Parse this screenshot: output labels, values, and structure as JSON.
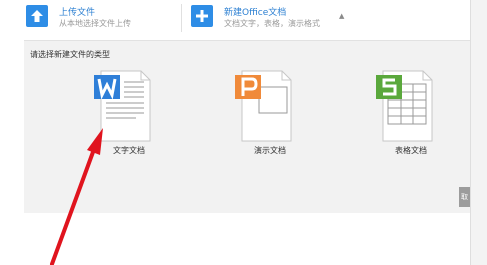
{
  "toolbar": {
    "upload": {
      "title": "上传文件",
      "subtitle": "从本地选择文件上传",
      "icon": "upload-arrow-icon"
    },
    "new_office": {
      "title": "新建Office文档",
      "subtitle": "文档文字，表格，演示格式",
      "icon": "plus-icon"
    },
    "collapse_caret": "▲"
  },
  "panel": {
    "prompt": "请选择新建文件的类型",
    "file_types": [
      {
        "label": "文字文档",
        "icon": "word-document-icon",
        "letter": "W",
        "color": "#2f7fd8"
      },
      {
        "label": "演示文档",
        "icon": "presentation-document-icon",
        "letter": "P",
        "color": "#f08a3a"
      },
      {
        "label": "表格文档",
        "icon": "spreadsheet-document-icon",
        "letter": "S",
        "color": "#5aa83c"
      }
    ]
  },
  "side_button": "取",
  "colors": {
    "accent": "#2e8de6",
    "panel_bg": "#f2f2f2",
    "annotation_arrow": "#e0141e"
  }
}
